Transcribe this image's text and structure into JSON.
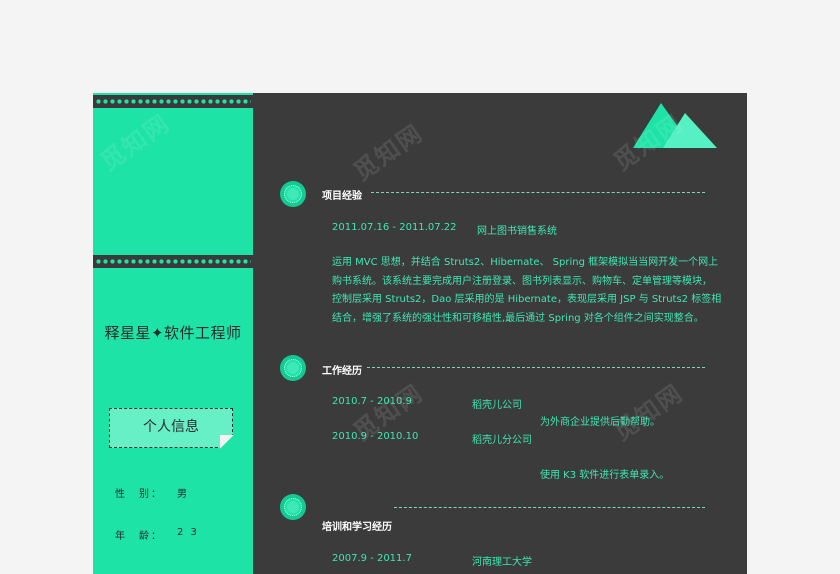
{
  "profile": {
    "name_title": "释星星✦软件工程师",
    "info_tag": "个人信息",
    "fields": [
      {
        "label": "性　别：",
        "value": "男"
      },
      {
        "label": "年　龄：",
        "value": "2 3"
      }
    ]
  },
  "watermark": "觅知网",
  "colors": {
    "accent": "#1ee3a6",
    "dark": "#3b3b3b",
    "text": "#3ee7b3"
  },
  "sections": {
    "project": {
      "title": "项目经验",
      "date": "2011.07.16 - 2011.07.22",
      "name": "网上图书销售系统",
      "lines": [
        "运用 MVC 思想，并结合 Struts2、Hibernate、 Spring 框架模拟当当网开发一个网上",
        "购书系统。该系统主要完成用户注册登录、图书列表显示、购物车、定单管理等模块，",
        "控制层采用 Struts2，Dao 层采用的是 Hibernate，表现层采用 JSP 与 Struts2 标签相",
        "结合，增强了系统的强壮性和可移植性,最后通过 Spring 对各个组件之间实现整合。"
      ]
    },
    "work": {
      "title": "工作经历",
      "items": [
        {
          "date": "2010.7 - 2010.9",
          "company": "稻壳儿公司",
          "desc": "为外商企业提供后勤帮助。"
        },
        {
          "date": "2010.9 - 2010.10",
          "company": "稻壳儿分公司",
          "desc": "使用 K3 软件进行表单录入。"
        }
      ]
    },
    "education": {
      "title": "培训和学习经历",
      "items": [
        {
          "date": "2007.9 - 2011.7",
          "school": "河南理工大学"
        }
      ]
    }
  }
}
